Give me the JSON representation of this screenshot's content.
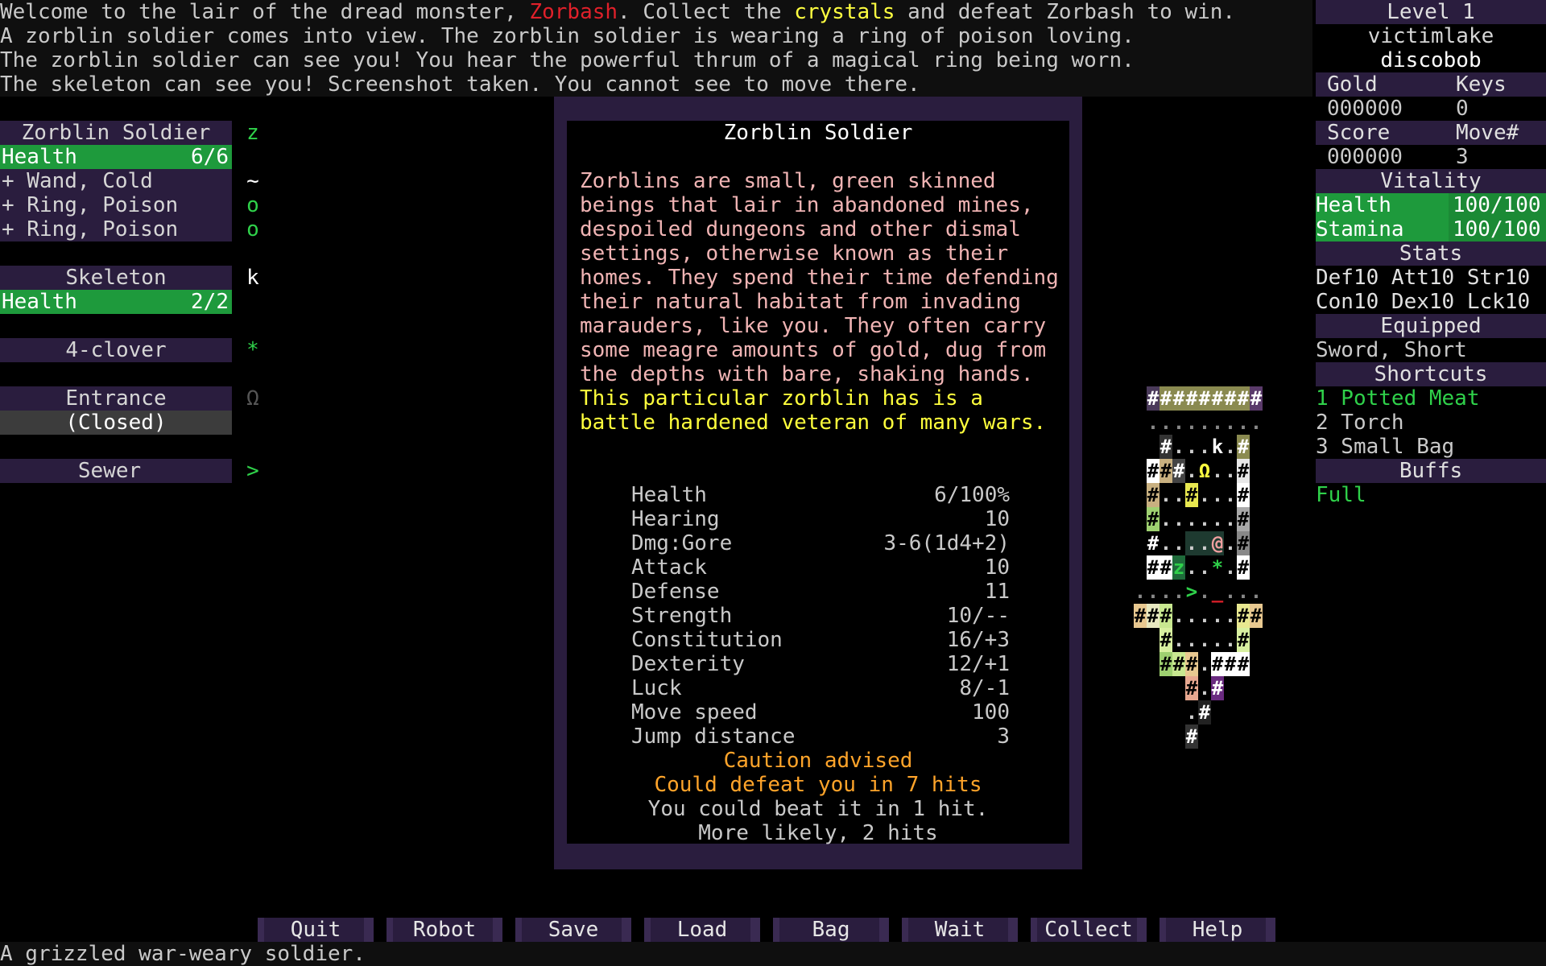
{
  "messages": {
    "line1_a": "Welcome to the lair of the dread monster, ",
    "line1_b": "Zorbash",
    "line1_c": ". Collect the ",
    "line1_d": "crystals",
    "line1_e": " and defeat Zorbash to win.",
    "line2": "A zorblin soldier comes into view. The zorblin soldier is wearing a ring of poison loving.",
    "line3": "The zorblin soldier can see you! You hear the powerful thrum of a magical ring being worn.",
    "line4": "The skeleton can see you! Screenshot taken. You cannot see to move there."
  },
  "left_panel": {
    "zorblin": {
      "name": "Zorblin Soldier",
      "glyph": "z",
      "health_label": "Health",
      "health_value": "6/6",
      "health_fraction": 1.0,
      "items": [
        "+ Wand, Cold",
        "+ Ring, Poison",
        "+ Ring, Poison"
      ],
      "item_glyphs": [
        "~",
        "o",
        "o"
      ]
    },
    "skeleton": {
      "name": "Skeleton",
      "glyph": "k",
      "health_label": "Health",
      "health_value": "2/2"
    },
    "clover": {
      "name": "4-clover",
      "glyph": "*"
    },
    "entrance": {
      "name": "Entrance",
      "status": "(Closed)",
      "glyph": "Ω"
    },
    "sewer": {
      "name": "Sewer",
      "glyph": ">"
    }
  },
  "dialog": {
    "title": "Zorblin Soldier",
    "description": "Zorblins are small, green skinned beings that lair in abandoned mines, despoiled dungeons and other dismal settings, otherwise known as their homes. They spend their time defending their natural habitat from invading marauders, like you. They often carry some meagre amounts of gold, dug from the depths with bare, shaking hands.",
    "description_highlight": "This particular zorblin has is a battle hardened veteran of many wars.",
    "stats": [
      {
        "label": "Health",
        "value": "6/100%"
      },
      {
        "label": "Hearing",
        "value": "10"
      },
      {
        "label": "Dmg:Gore",
        "value": "3-6(1d4+2)"
      },
      {
        "label": "Attack",
        "value": "10"
      },
      {
        "label": "Defense",
        "value": "11"
      },
      {
        "label": "Strength",
        "value": "10/--"
      },
      {
        "label": "Constitution",
        "value": "16/+3"
      },
      {
        "label": "Dexterity",
        "value": "12/+1"
      },
      {
        "label": "Luck",
        "value": "8/-1"
      },
      {
        "label": "Move speed",
        "value": "100"
      },
      {
        "label": "Jump distance",
        "value": "3"
      }
    ],
    "caution": "Caution advised",
    "defeat_you": "Could defeat you in 7 hits",
    "you_beat": "You could beat it in 1 hit.",
    "likely": "More likely, 2 hits"
  },
  "right_panel": {
    "level": "Level 1",
    "dungeon_name": "victimlake",
    "player_name": "discobob",
    "gold_label": "Gold",
    "keys_label": "Keys",
    "gold_value": "000000",
    "keys_value": "0",
    "score_label": "Score",
    "move_label": "Move#",
    "score_value": "000000",
    "move_value": "3",
    "vitality_header": "Vitality",
    "health_label": "Health",
    "health_value": "100/100",
    "stamina_label": "Stamina",
    "stamina_value": "100/100",
    "stats_header": "Stats",
    "stats_line1": "Def10 Att10 Str10",
    "stats_line2": "Con10 Dex10 Lck10",
    "equipped_header": "Equipped",
    "equipped_item": "Sword, Short",
    "shortcuts_header": "Shortcuts",
    "shortcuts": [
      "1 Potted Meat",
      "2 Torch",
      "3 Small Bag"
    ],
    "buffs_header": "Buffs",
    "buffs": "Full"
  },
  "buttons": [
    "Quit",
    "Robot",
    "Save",
    "Load",
    "Bag",
    "Wait",
    "Collect",
    "Help"
  ],
  "status": "A grizzled war-weary soldier.",
  "colors": {
    "panel": "#2a1d3e",
    "health_bar": "#1e9a3c",
    "text": "#c9c9c9",
    "monster_name": "#e0202a",
    "highlight": "#ffff40",
    "caution": "#ffa42a"
  }
}
